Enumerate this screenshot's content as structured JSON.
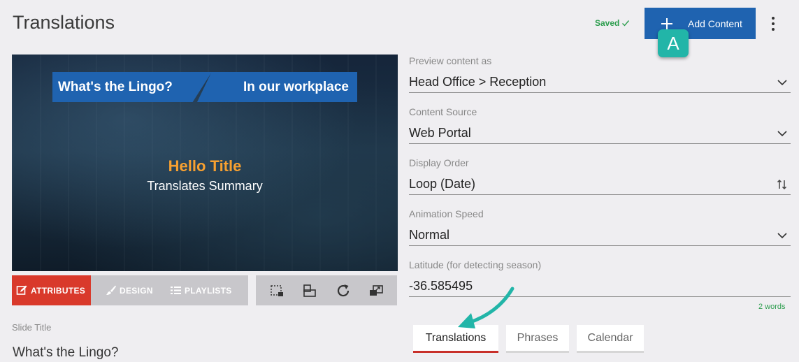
{
  "header": {
    "title": "Translations",
    "saved_label": "Saved",
    "add_content_label": "Add Content",
    "badge_letter": "A"
  },
  "preview": {
    "banner_left": "What's the Lingo?",
    "banner_right": "In our workplace",
    "hello_title": "Hello Title",
    "summary": "Translates Summary"
  },
  "editor_tabs": {
    "attributes": "ATTRIBUTES",
    "design": "DESIGN",
    "playlists": "PLAYLISTS"
  },
  "slide": {
    "title_label": "Slide Title",
    "title_value": "What's the Lingo?"
  },
  "form": {
    "preview_as": {
      "label": "Preview content as",
      "value": "Head Office > Reception"
    },
    "content_source": {
      "label": "Content Source",
      "value": "Web Portal"
    },
    "display_order": {
      "label": "Display Order",
      "value": "Loop (Date)"
    },
    "animation_speed": {
      "label": "Animation Speed",
      "value": "Normal"
    },
    "latitude": {
      "label": "Latitude (for detecting season)",
      "value": "-36.585495"
    },
    "word_count": "2 words"
  },
  "bottom_tabs": {
    "translations": "Translations",
    "phrases": "Phrases",
    "calendar": "Calendar"
  },
  "colors": {
    "primary": "#1f63b0",
    "accent_teal": "#22b5a8",
    "active_tab": "#d9392b",
    "saved_green": "#2e9e4f",
    "title_orange": "#f7a030"
  }
}
